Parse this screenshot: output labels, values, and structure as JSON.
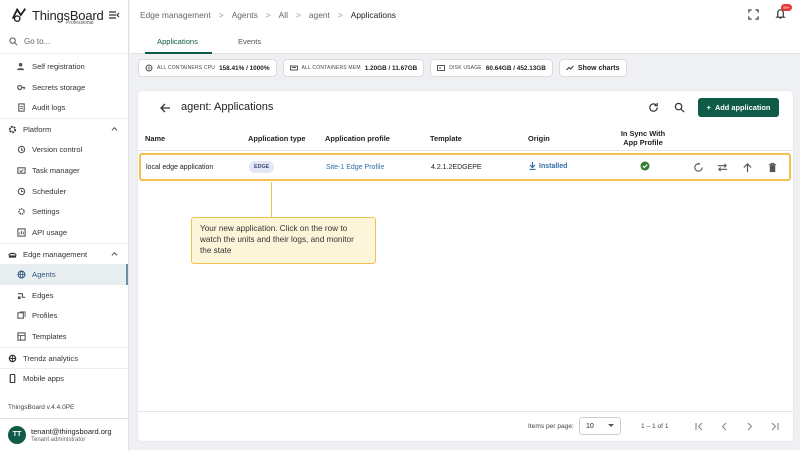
{
  "app": {
    "logo_text": "ThingsBoard",
    "logo_sub": "Professional",
    "search_placeholder": "Go to...",
    "version": "ThingsBoard v.4.4.0PE"
  },
  "sidebar": {
    "items": [
      {
        "label": "Self registration",
        "icon": "person-add-icon",
        "type": "sub"
      },
      {
        "label": "Secrets storage",
        "icon": "key-icon",
        "type": "sub"
      },
      {
        "label": "Audit logs",
        "icon": "document-icon",
        "type": "sub"
      },
      {
        "label": "Platform",
        "icon": "settings-icon",
        "type": "group"
      },
      {
        "label": "Version control",
        "icon": "history-icon",
        "type": "sub"
      },
      {
        "label": "Task manager",
        "icon": "task-icon",
        "type": "sub"
      },
      {
        "label": "Scheduler",
        "icon": "clock-icon",
        "type": "sub"
      },
      {
        "label": "Settings",
        "icon": "gear-icon",
        "type": "sub"
      },
      {
        "label": "API usage",
        "icon": "chart-icon",
        "type": "sub"
      },
      {
        "label": "Edge management",
        "icon": "edge-icon",
        "type": "group"
      },
      {
        "label": "Agents",
        "icon": "globe-icon",
        "type": "sub",
        "active": true
      },
      {
        "label": "Edges",
        "icon": "edges-icon",
        "type": "sub"
      },
      {
        "label": "Profiles",
        "icon": "profiles-icon",
        "type": "sub"
      },
      {
        "label": "Templates",
        "icon": "templates-icon",
        "type": "sub"
      },
      {
        "label": "Trendz analytics",
        "icon": "trendz-icon",
        "type": "group"
      },
      {
        "label": "Mobile apps",
        "icon": "mobile-icon",
        "type": "group"
      }
    ]
  },
  "user": {
    "initials": "TT",
    "email": "tenant@thingsboard.org",
    "role": "Tenant administrator"
  },
  "breadcrumb": [
    "Edge management",
    "Agents",
    "All",
    "agent",
    "Applications"
  ],
  "notifications_badge": "99+",
  "tabs": [
    "Applications",
    "Events"
  ],
  "stats": [
    {
      "label": "ALL CONTAINERS CPU",
      "value": "158.41% / 1000%"
    },
    {
      "label": "ALL CONTAINERS MEM",
      "value": "1.20GB / 11.67GB"
    },
    {
      "label": "DISK USAGE",
      "value": "60.64GB / 452.13GB"
    }
  ],
  "show_charts_label": "Show charts",
  "card": {
    "title": "agent: Applications",
    "add_label": "Add application",
    "columns": {
      "name": "Name",
      "type": "Application type",
      "profile": "Application profile",
      "template": "Template",
      "origin": "Origin",
      "sync_line1": "In Sync With",
      "sync_line2": "App Profile"
    },
    "row": {
      "name": "local edge application",
      "type": "EDGE",
      "profile": "Site-1 Edge Profile",
      "template": "4.2.1.2EDGEPE",
      "origin": "Installed"
    }
  },
  "tooltip": "Your new application. Click on the row to watch the units and their logs, and monitor the state",
  "pagination": {
    "items_per_page_label": "Items per page:",
    "items_per_page": "10",
    "range": "1 – 1 of 1"
  },
  "colors": {
    "primary": "#0f5b47",
    "highlight": "#f2c14e",
    "link": "#2f6fa8"
  }
}
